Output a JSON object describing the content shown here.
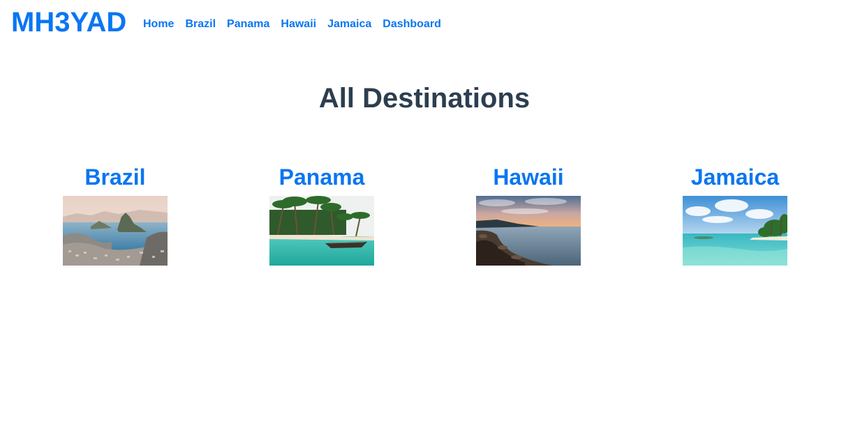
{
  "header": {
    "brand": "MH3YAD",
    "nav": [
      {
        "label": "Home"
      },
      {
        "label": "Brazil"
      },
      {
        "label": "Panama"
      },
      {
        "label": "Hawaii"
      },
      {
        "label": "Jamaica"
      },
      {
        "label": "Dashboard"
      }
    ]
  },
  "main": {
    "title": "All Destinations",
    "destinations": [
      {
        "name": "Brazil",
        "image": "rio-de-janeiro-bay-photo"
      },
      {
        "name": "Panama",
        "image": "palm-beach-canoe-photo"
      },
      {
        "name": "Hawaii",
        "image": "rocky-coast-sunset-photo"
      },
      {
        "name": "Jamaica",
        "image": "tropical-island-lagoon-photo"
      }
    ]
  },
  "colors": {
    "link": "#0a76f2",
    "heading": "#2c3e50",
    "background": "#ffffff"
  }
}
